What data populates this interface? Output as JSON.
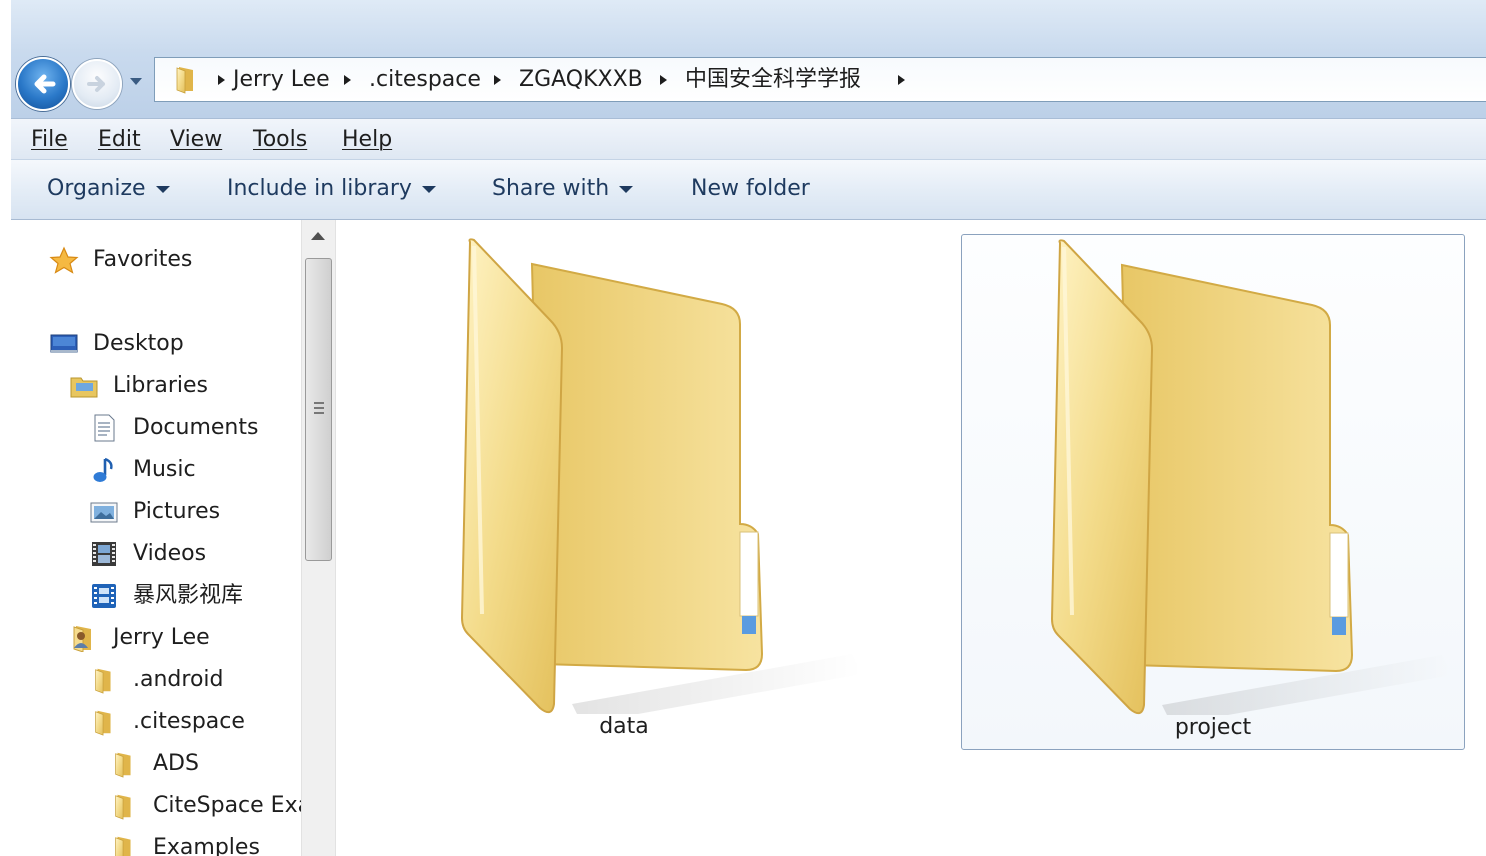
{
  "address_bar": {
    "breadcrumbs": [
      "Jerry Lee",
      ".citespace",
      "ZGAQKXXB",
      "中国安全科学学报"
    ]
  },
  "menu": {
    "items": [
      {
        "label": "File"
      },
      {
        "label": "Edit"
      },
      {
        "label": "View"
      },
      {
        "label": "Tools"
      },
      {
        "label": "Help"
      }
    ]
  },
  "toolbar": {
    "organize": "Organize",
    "include_in_library": "Include in library",
    "share_with": "Share with",
    "new_folder": "New folder"
  },
  "sidebar": {
    "items": [
      {
        "label": "Favorites",
        "icon": "star-icon"
      },
      {
        "label": "Desktop",
        "icon": "desktop-icon"
      },
      {
        "label": "Libraries",
        "icon": "libraries-icon"
      },
      {
        "label": "Documents",
        "icon": "document-icon"
      },
      {
        "label": "Music",
        "icon": "music-icon"
      },
      {
        "label": "Pictures",
        "icon": "pictures-icon"
      },
      {
        "label": "Videos",
        "icon": "videos-icon"
      },
      {
        "label": "暴风影视库",
        "icon": "video-library-icon"
      },
      {
        "label": "Jerry Lee",
        "icon": "user-folder-icon"
      },
      {
        "label": ".android",
        "icon": "folder-icon"
      },
      {
        "label": ".citespace",
        "icon": "folder-icon"
      },
      {
        "label": "ADS",
        "icon": "folder-icon"
      },
      {
        "label": "CiteSpace Exa",
        "icon": "folder-icon"
      },
      {
        "label": "Examples",
        "icon": "folder-icon"
      }
    ]
  },
  "content": {
    "items": [
      {
        "label": "data",
        "icon": "folder-icon",
        "selected": false
      },
      {
        "label": "project",
        "icon": "folder-icon",
        "selected": true
      }
    ]
  },
  "colors": {
    "title_gradient_top": "#dfeaf6",
    "title_gradient_bottom": "#bcd0e8",
    "folder_yellow": "#f0d882",
    "selection_border": "#8ba2be"
  }
}
